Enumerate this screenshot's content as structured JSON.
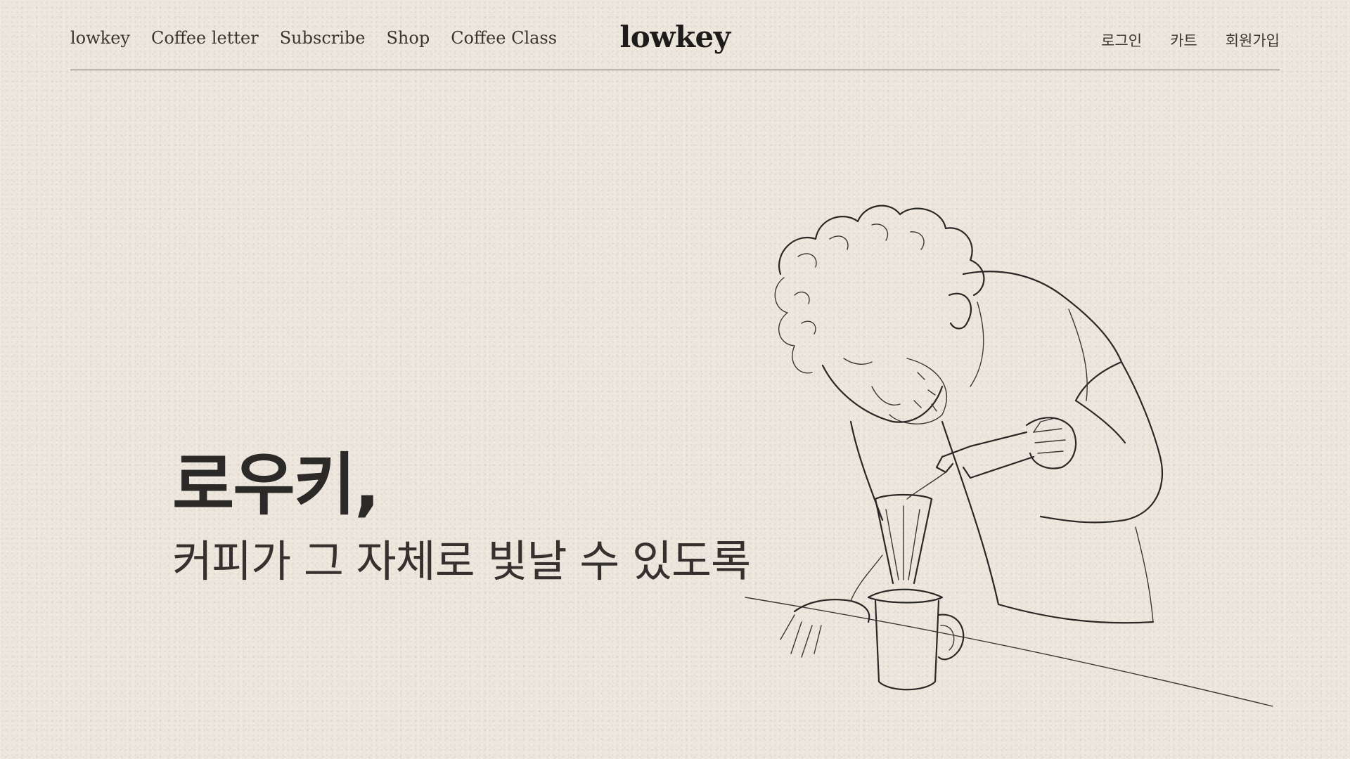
{
  "header": {
    "nav_left": [
      {
        "label": "lowkey"
      },
      {
        "label": "Coffee letter"
      },
      {
        "label": "Subscribe"
      },
      {
        "label": "Shop"
      },
      {
        "label": "Coffee Class"
      }
    ],
    "brand": "lowkey",
    "nav_right": [
      {
        "label": "로그인"
      },
      {
        "label": "카트"
      },
      {
        "label": "회원가입"
      }
    ]
  },
  "hero": {
    "title": "로우키,",
    "subtitle": "커피가 그 자체로 빛날 수 있도록"
  },
  "illustration": {
    "icon": "barista-pour-over-sketch"
  },
  "colors": {
    "background": "#ece6dd",
    "text": "#2b2826",
    "rule": "#6e6a66"
  }
}
